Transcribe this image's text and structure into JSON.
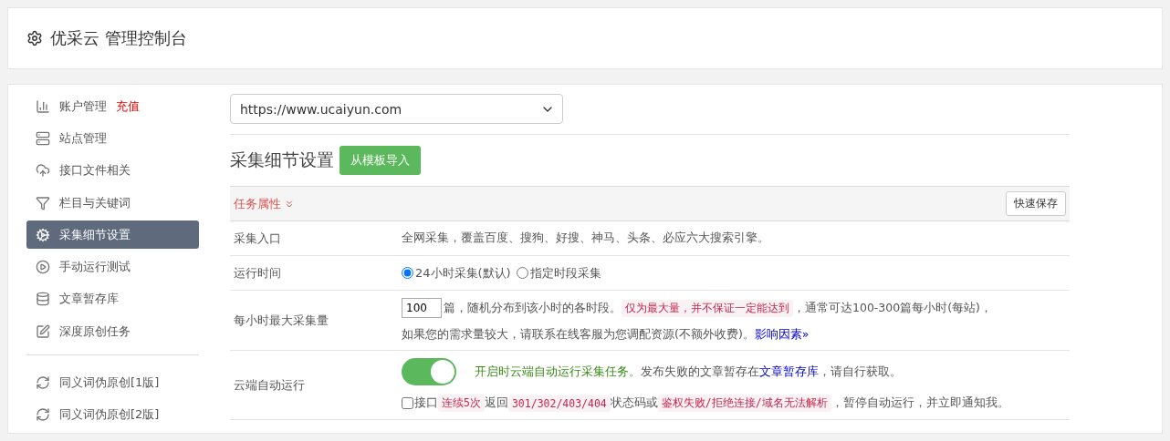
{
  "header": {
    "title": "优采云 管理控制台"
  },
  "sidebar": {
    "groups": [
      [
        {
          "label": "账户管理",
          "badge": "充值",
          "selected": false
        },
        {
          "label": "站点管理",
          "selected": false
        },
        {
          "label": "接口文件相关",
          "selected": false
        },
        {
          "label": "栏目与关键词",
          "selected": false
        },
        {
          "label": "采集细节设置",
          "selected": true
        },
        {
          "label": "手动运行测试",
          "selected": false
        },
        {
          "label": "文章暂存库",
          "selected": false
        },
        {
          "label": "深度原创任务",
          "selected": false
        }
      ],
      [
        {
          "label": "同义词伪原创[1版]",
          "selected": false
        },
        {
          "label": "同义词伪原创[2版]",
          "selected": false
        }
      ]
    ]
  },
  "site_select": {
    "value": "https://www.ucaiyun.com"
  },
  "section": {
    "title": "采集细节设置",
    "import_button": "从模板导入"
  },
  "panel": {
    "tab": "任务属性",
    "save_button": "快速保存",
    "rows": [
      {
        "kind": "text",
        "label": "采集入口",
        "lines": [
          [
            {
              "kind": "plain",
              "text": "全网采集，覆盖百度、搜狗、好搜、神马、头条、必应六大搜索引擎。"
            }
          ]
        ]
      },
      {
        "kind": "radios",
        "label": "运行时间",
        "options": [
          {
            "label": "24小时采集(默认)",
            "selected": true
          },
          {
            "label": "指定时段采集",
            "selected": false
          }
        ]
      },
      {
        "kind": "number",
        "label": "每小时最大采集量",
        "value": "100",
        "lines": [
          [
            {
              "kind": "plain",
              "text": "篇，随机分布到该小时的各时段。"
            },
            {
              "kind": "code",
              "text": "仅为最大量，并不保证一定能达到"
            },
            {
              "kind": "plain",
              "text": "，通常可达100-300篇每小时(每站)，"
            }
          ],
          [
            {
              "kind": "plain",
              "text": "如果您的需求量较大，请联系在线客服为您调配资源(不额外收费)。"
            },
            {
              "kind": "link",
              "text": "影响因素»"
            }
          ]
        ]
      },
      {
        "kind": "toggle",
        "label": "云端自动运行",
        "on": true,
        "lines": [
          [
            {
              "kind": "green",
              "text": "开启时云端自动运行采集任务。"
            },
            {
              "kind": "plain",
              "text": "发布失败的文章暂存在"
            },
            {
              "kind": "link",
              "text": "文章暂存库"
            },
            {
              "kind": "plain",
              "text": "，请自行获取。"
            }
          ]
        ],
        "check": {
          "checked": false,
          "segments": [
            {
              "kind": "plain",
              "text": "接口"
            },
            {
              "kind": "code",
              "text": "连续5次"
            },
            {
              "kind": "plain",
              "text": "返回"
            },
            {
              "kind": "code",
              "text": "301/302/403/404"
            },
            {
              "kind": "plain",
              "text": "状态码或"
            },
            {
              "kind": "code",
              "text": "鉴权失败/拒绝连接/域名无法解析"
            },
            {
              "kind": "plain",
              "text": "，暂停自动运行，并立即通知我。"
            }
          ]
        }
      }
    ]
  }
}
